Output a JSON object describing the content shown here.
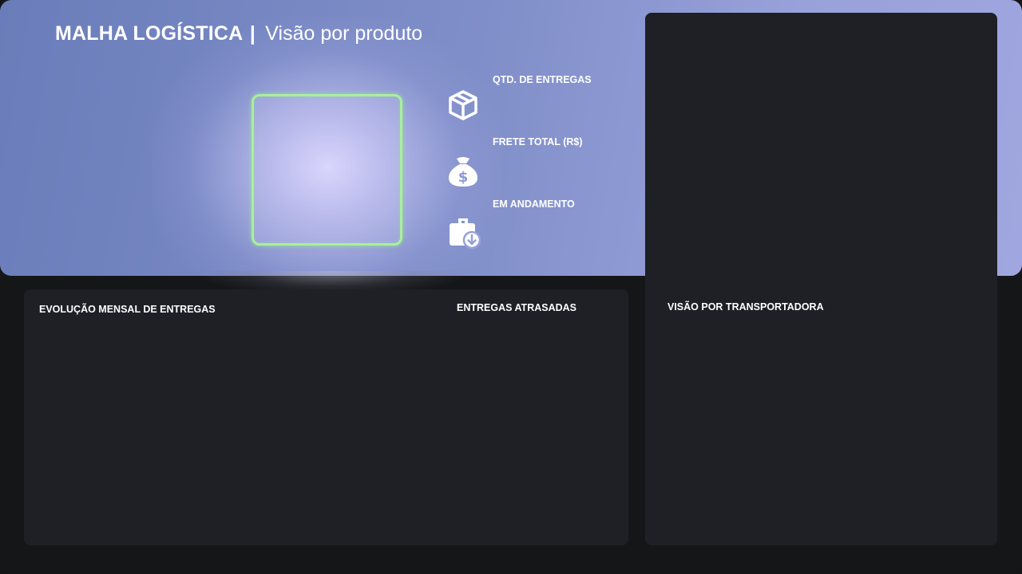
{
  "header": {
    "title": "MALHA LOGÍSTICA",
    "separator": "|",
    "subtitle": "Visão por produto"
  },
  "kpis": [
    {
      "label": "QTD. DE ENTREGAS",
      "icon": "package-box-icon"
    },
    {
      "label": "FRETE TOTAL (R$)",
      "icon": "money-bag-icon"
    },
    {
      "label": "EM ANDAMENTO",
      "icon": "briefcase-download-icon"
    }
  ],
  "panels": {
    "monthly_evolution": {
      "title": "EVOLUÇÃO MENSAL DE ENTREGAS"
    },
    "late_deliveries": {
      "title": "ENTREGAS ATRASADAS"
    },
    "carriers": {
      "title": "VISÃO POR TRANSPORTADORA"
    }
  },
  "colors": {
    "hero_start": "#6a7dba",
    "hero_end": "#a0a6df",
    "panel_bg": "#1e2025",
    "page_bg": "#151618",
    "frame_accent": "#a9ef9c"
  }
}
